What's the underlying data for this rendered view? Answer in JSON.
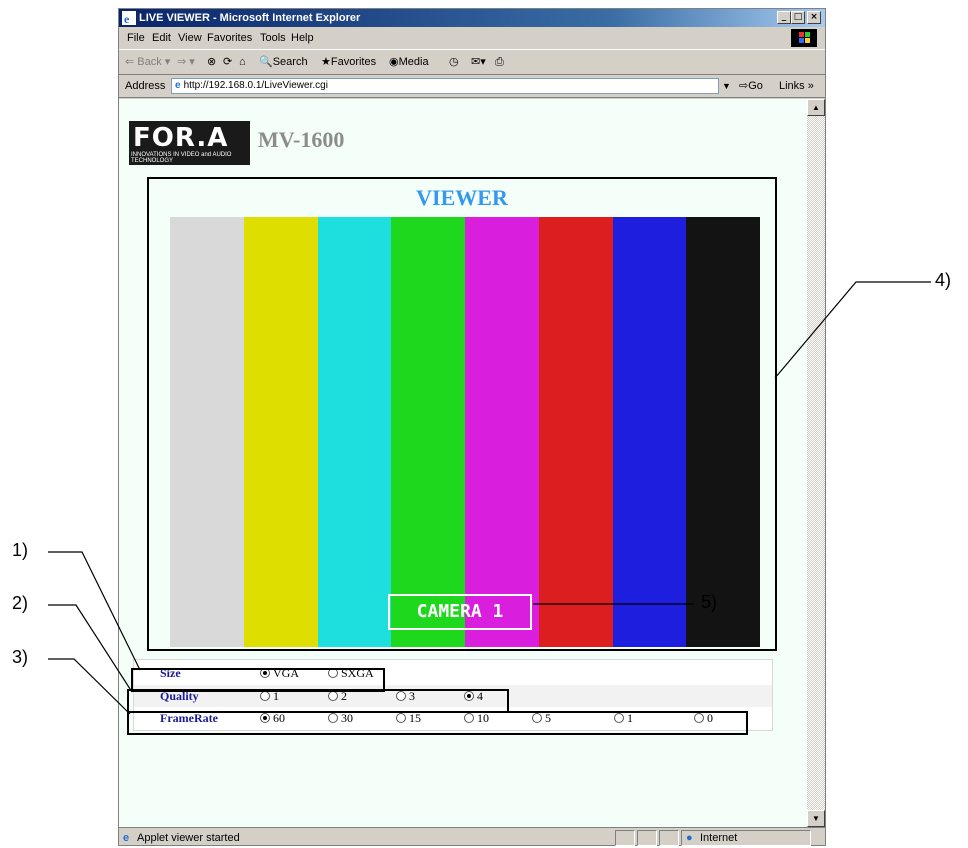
{
  "window": {
    "title": "LIVE VIEWER - Microsoft Internet Explorer"
  },
  "menu": [
    "File",
    "Edit",
    "View",
    "Favorites",
    "Tools",
    "Help"
  ],
  "toolbar": {
    "back": "Back",
    "search": "Search",
    "favorites": "Favorites",
    "media": "Media"
  },
  "address": {
    "label": "Address",
    "url": "http://192.168.0.1/LiveViewer.cgi",
    "go": "Go",
    "links": "Links"
  },
  "page": {
    "logo_text": "FOR.A",
    "logo_tagline": "INNOVATIONS IN VIDEO and AUDIO TECHNOLOGY",
    "model": "MV-1600",
    "viewer_title": "VIEWER",
    "camera_label": "CAMERA 1",
    "color_bars": [
      "#d9d9d9",
      "#dede00",
      "#1edede",
      "#1ed81e",
      "#d91ede",
      "#dc1e1e",
      "#1e1ede",
      "#131313"
    ]
  },
  "controls": {
    "size": {
      "label": "Size",
      "options": [
        "VGA",
        "SXGA"
      ],
      "selected": "VGA"
    },
    "quality": {
      "label": "Quality",
      "options": [
        "1",
        "2",
        "3",
        "4"
      ],
      "selected": "4"
    },
    "framerate": {
      "label": "FrameRate",
      "options": [
        "60",
        "30",
        "15",
        "10",
        "5",
        "1",
        "0"
      ],
      "selected": "60"
    }
  },
  "status": {
    "text": "Applet viewer started",
    "zone": "Internet"
  },
  "callouts": {
    "c1": "1)",
    "c2": "2)",
    "c3": "3)",
    "c4": "4)",
    "c5": "5)"
  }
}
